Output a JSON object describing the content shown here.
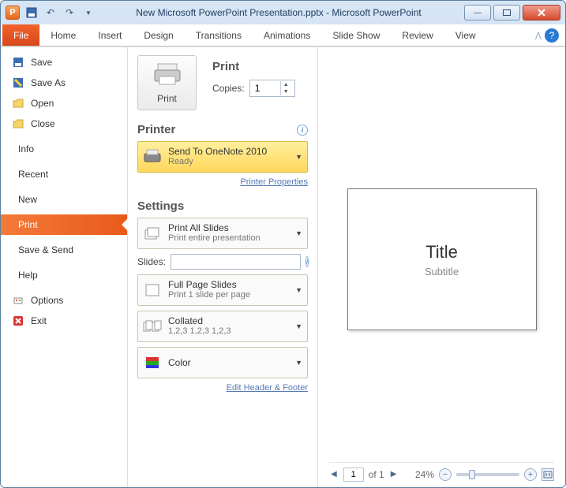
{
  "title": "New Microsoft PowerPoint Presentation.pptx - Microsoft PowerPoint",
  "app_icon_letter": "P",
  "tabs": {
    "file": "File",
    "home": "Home",
    "insert": "Insert",
    "design": "Design",
    "transitions": "Transitions",
    "animations": "Animations",
    "slideshow": "Slide Show",
    "review": "Review",
    "view": "View"
  },
  "leftmenu": {
    "save": "Save",
    "save_as": "Save As",
    "open": "Open",
    "close": "Close",
    "info": "Info",
    "recent": "Recent",
    "new": "New",
    "print": "Print",
    "save_send": "Save & Send",
    "help": "Help",
    "options": "Options",
    "exit": "Exit"
  },
  "print": {
    "section": "Print",
    "button": "Print",
    "copies_label": "Copies:",
    "copies_value": "1"
  },
  "printer": {
    "section": "Printer",
    "selected": "Send To OneNote 2010",
    "status": "Ready",
    "link": "Printer Properties"
  },
  "settings": {
    "section": "Settings",
    "all_slides": {
      "title": "Print All Slides",
      "sub": "Print entire presentation"
    },
    "slides_label": "Slides:",
    "full_page": {
      "title": "Full Page Slides",
      "sub": "Print 1 slide per page"
    },
    "collated": {
      "title": "Collated",
      "sub": "1,2,3   1,2,3   1,2,3"
    },
    "color": {
      "title": "Color"
    },
    "edit_hf": "Edit Header & Footer"
  },
  "preview": {
    "title": "Title",
    "subtitle": "Subtitle"
  },
  "nav": {
    "page": "1",
    "of": "of 1",
    "zoom": "24%"
  }
}
